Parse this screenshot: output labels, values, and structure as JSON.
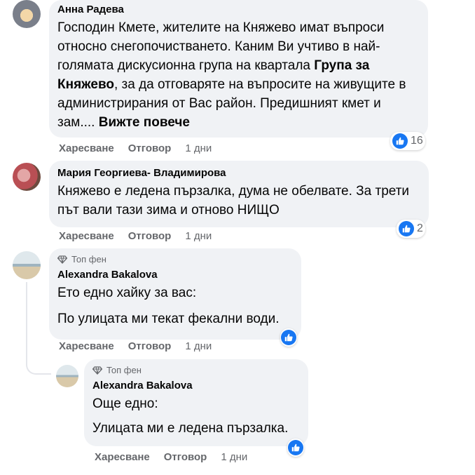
{
  "comments": [
    {
      "author": "Анна Радева",
      "text_parts": [
        "Господин Кмете, жителите на Княжево имат въпроси относно снегопочистването. Каним Ви учтиво в най-голямата дискусионна група на квартала ",
        "Група за Княжево",
        ", за да отговаряте на въпросите на живущите в администрирания от Вас район. Предишният кмет и зам.... "
      ],
      "see_more": "Вижте повече",
      "like_label": "Харесване",
      "reply_label": "Отговор",
      "time": "1 дни",
      "reactions": "16"
    },
    {
      "author": "Мария Георгиева- Владимирова",
      "text": "Княжево е ледена пързалка, дума не обелвате. За трети път вали тази зима и отново НИЩО",
      "like_label": "Харесване",
      "reply_label": "Отговор",
      "time": "1 дни",
      "reactions": "2"
    },
    {
      "badge": "Топ фен",
      "author": "Alexandra Bakalova",
      "line1": "Ето едно хайку за вас:",
      "line2": "По улицата ми текат фекални води.",
      "like_label": "Харесване",
      "reply_label": "Отговор",
      "time": "1 дни"
    },
    {
      "badge": "Топ фен",
      "author": "Alexandra Bakalova",
      "line1": "Още едно:",
      "line2": "Улицата ми е ледена пързалка.",
      "like_label": "Харесване",
      "reply_label": "Отговор",
      "time": "1 дни"
    }
  ],
  "colors": {
    "bubble": "#f0f2f5",
    "like_blue": "#1877f2",
    "muted": "#65676b"
  },
  "icons": {
    "like": "like-icon",
    "badge": "diamond-icon"
  }
}
